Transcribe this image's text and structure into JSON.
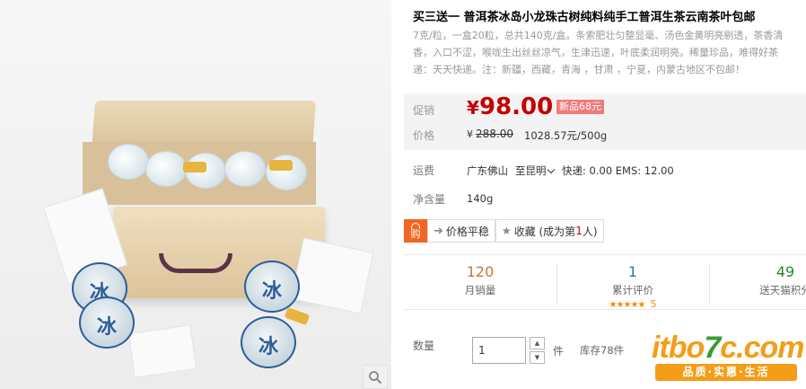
{
  "product": {
    "title": "买三送一 普洱茶冰岛小龙珠古树纯料纯手工普洱生茶云南茶叶包邮",
    "description_lines": [
      "7克/粒，一盒20粒，总共140克/盒。条索肥壮匀整显毫、汤色金黄明亮剔透，茶香清",
      "香，入口不涩，喉咙生出丝丝凉气，生津迅速，叶底柔润明亮。稀量珍品，难得好茶",
      "递：天天快递。注：新疆，西藏，青海 ，甘肃 ，宁夏，内蒙古地区不包邮！"
    ],
    "image_stamp": "冰"
  },
  "price": {
    "promo_label": "促销",
    "currency": "¥",
    "promo_price": "98.00",
    "new_badge": "新品68元",
    "orig_label": "价格",
    "orig_currency": "¥",
    "orig_price": "288.00",
    "unit_price": "1028.57元/500g"
  },
  "shipping": {
    "label": "运费",
    "origin": "广东佛山",
    "destination": "至昆明",
    "fees": "快递: 0.00 EMS: 12.00"
  },
  "net_weight": {
    "label": "净含量",
    "value": "140g"
  },
  "actions": {
    "buy_badge": "购",
    "price_stable": "价格平稳",
    "favorite_prefix": "收藏 (成为第",
    "favorite_rank": "1",
    "favorite_suffix": "人)"
  },
  "stats": [
    {
      "value": "120",
      "label": "月销量",
      "color": "#c07a3a"
    },
    {
      "value": "1",
      "label": "累计评价",
      "color": "#3870c0"
    },
    {
      "value": "49",
      "label": "送天猫积分",
      "color": "#2a8a2a"
    }
  ],
  "rating": {
    "stars": "★★★★★",
    "score": "5"
  },
  "quantity": {
    "label": "数量",
    "value": "1",
    "up": "▲",
    "down": "▼",
    "unit": "件",
    "stock": "库存78件"
  },
  "watermark": {
    "brand_part1": "itbo",
    "brand_part2": "7",
    "brand_part3": "c.com",
    "tagline": "品质·实惠·生活"
  }
}
